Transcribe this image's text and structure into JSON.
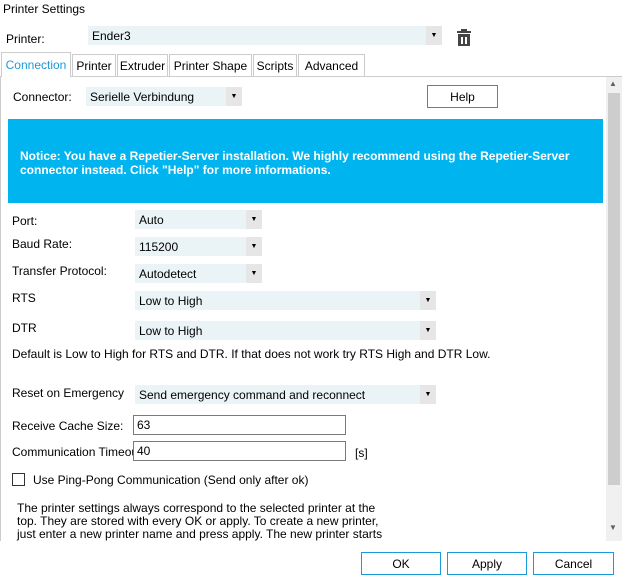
{
  "window": {
    "title": "Printer Settings"
  },
  "printer": {
    "label": "Printer:",
    "value": "Ender3"
  },
  "tabs": [
    {
      "label": "Connection",
      "active": true
    },
    {
      "label": "Printer"
    },
    {
      "label": "Extruder"
    },
    {
      "label": "Printer Shape"
    },
    {
      "label": "Scripts"
    },
    {
      "label": "Advanced"
    }
  ],
  "connection": {
    "connector_label": "Connector:",
    "connector_value": "Serielle Verbindung",
    "help_label": "Help",
    "notice": "Notice: You have a Repetier-Server installation. We highly recommend using the Repetier-Server connector instead. Click \"Help\" for more informations.",
    "notice_color": "#00b4f0",
    "port_label": "Port:",
    "port_value": "Auto",
    "baud_label": "Baud Rate:",
    "baud_value": "115200",
    "protocol_label": "Transfer Protocol:",
    "protocol_value": "Autodetect",
    "rts_label": "RTS",
    "rts_value": "Low to High",
    "dtr_label": "DTR",
    "dtr_value": "Low to High",
    "default_note": "Default is Low to High for RTS and DTR. If that does not work try RTS High and DTR Low.",
    "reset_label": "Reset on Emergency",
    "reset_value": "Send emergency command and reconnect",
    "cache_label": "Receive Cache Size:",
    "cache_value": "63",
    "timeout_label": "Communication Timeout:",
    "timeout_value": "40",
    "timeout_unit": "[s]",
    "pingpong_label": "Use Ping-Pong Communication (Send only after ok)",
    "pingpong_checked": false,
    "info_text": "The printer settings always correspond to the selected printer at the top. They are stored with every OK or apply. To create a new printer, just enter a new printer name and press apply. The new printer starts with the last settings."
  },
  "footer": {
    "ok": "OK",
    "apply": "Apply",
    "cancel": "Cancel"
  }
}
